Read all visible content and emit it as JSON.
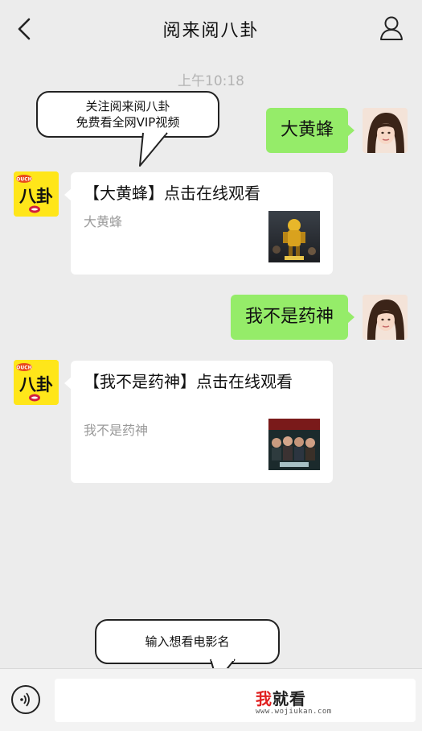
{
  "header": {
    "title": "阅来阅八卦",
    "back_icon": "chevron-left-icon",
    "profile_icon": "person-icon"
  },
  "timestamp": "上午10:18",
  "callouts": {
    "top_line1": "关注阅来阅八卦",
    "top_line2": "免费看全网VIP视频",
    "bottom": "输入想看电影名"
  },
  "messages": [
    {
      "type": "user_text",
      "text": "大黄蜂"
    },
    {
      "type": "bot_card",
      "title": "【大黄蜂】点击在线观看",
      "desc": "大黄蜂"
    },
    {
      "type": "user_text",
      "text": "我不是药神"
    },
    {
      "type": "bot_card",
      "title": "【我不是药神】点击在线观看",
      "desc": "我不是药神"
    }
  ],
  "bot_avatar": {
    "badge": "OUCH",
    "text": "八卦"
  },
  "input": {
    "value": "",
    "placeholder": ""
  },
  "watermark": {
    "brand_red": "我",
    "brand_rest": "就看",
    "url": "www.wojiukan.com"
  },
  "colors": {
    "green_bubble": "#95ec69",
    "background": "#ececec",
    "bot_avatar_bg": "#ffe61a"
  }
}
